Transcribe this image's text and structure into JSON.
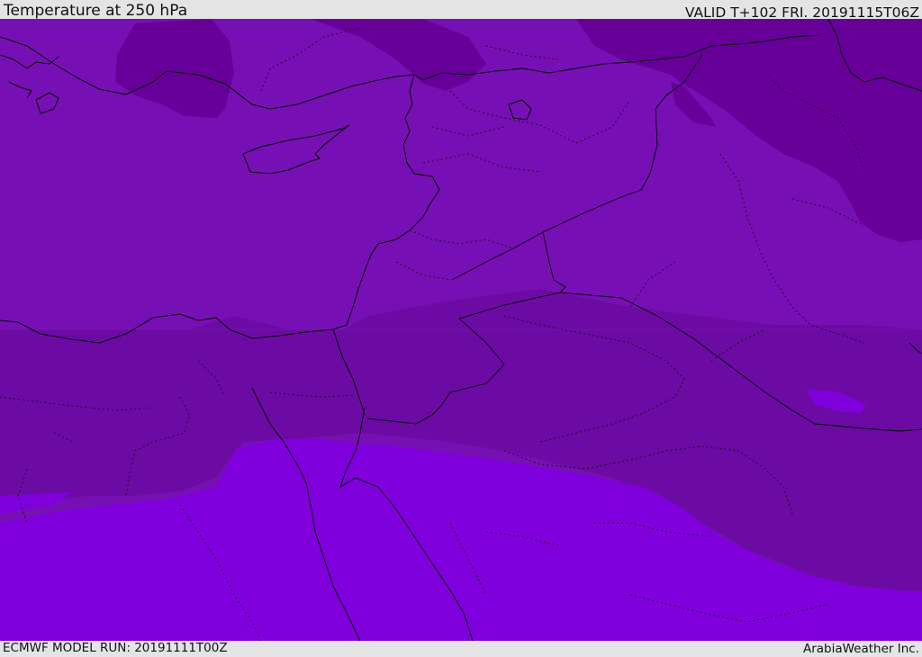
{
  "header": {
    "title": "Temperature at 250 hPa",
    "valid": "VALID T+102 FRI. 20191115T06Z"
  },
  "footer": {
    "model_run": "ECMWF MODEL RUN: 20191111T00Z",
    "credit": "ArabiaWeather Inc."
  },
  "colors": {
    "band_cold": "#660099",
    "band_cool": "#6c0ba4",
    "band_mid": "#7710b4",
    "band_warm": "#7f00dc",
    "background": "#e4e4e4"
  }
}
